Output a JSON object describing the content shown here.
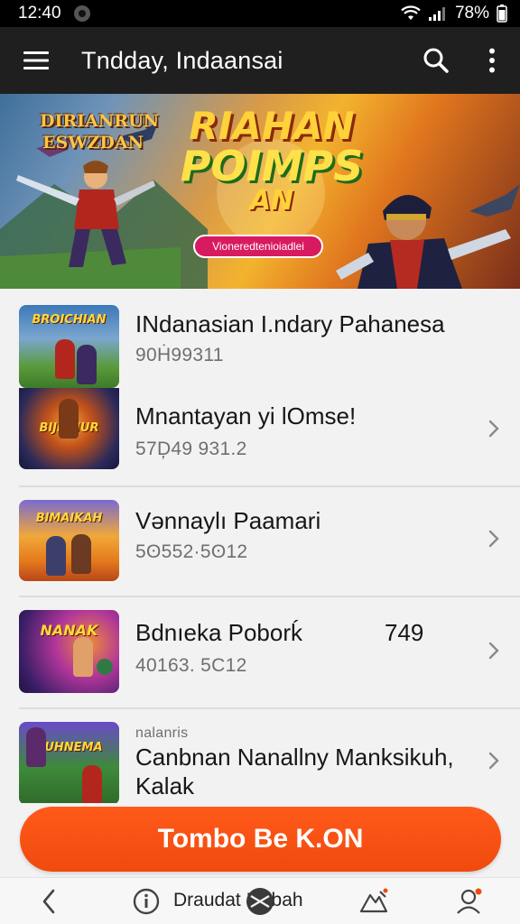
{
  "status_bar": {
    "time": "12:40",
    "battery": "78%"
  },
  "app_bar": {
    "title": "Tndday, Indaansai",
    "icons": [
      "menu-icon",
      "search-icon",
      "more-vert-icon"
    ]
  },
  "banner": {
    "logo_small_line1": "DIRIANRUN",
    "logo_small_line2": "ESWZDAN",
    "logo_big_line1": "RIAHAN",
    "logo_big_line2": "POIMPS",
    "logo_big_line3": "AN",
    "cta_label": "Vioneredtenioiadlei"
  },
  "list": {
    "items": [
      {
        "title": "INdanasian I.ndary Pahanesa",
        "subtitle": "90Ḣ99311",
        "thumb_label": "BROICHIAN",
        "has_chevron": false
      },
      {
        "title": "Mnantayan yi lOmse!",
        "subtitle": "57Ḑ49 931.2",
        "thumb_label": "BIJIAHUR",
        "has_chevron": true
      },
      {
        "title": "Vənnaylı Paamari",
        "subtitle": "5ʘ552·5ʘ12",
        "thumb_label": "BIMAIKAH",
        "has_chevron": true
      },
      {
        "title": "Bdnıeka Poborḱ",
        "badge": "749",
        "subtitle": "40163. 5C12",
        "thumb_label": "NANAK",
        "has_chevron": true
      },
      {
        "overline": "nalanris",
        "title": "Canbnan Nanallny Manksikuh,",
        "title_line2": "Kalak",
        "thumb_label": "BUHNEMA",
        "has_chevron": true
      }
    ]
  },
  "cta": {
    "label": "Tombo Be K.ON"
  },
  "bottom_nav": {
    "center_label": "Draudat Iatibah",
    "icons": [
      "back-icon",
      "info-icon",
      "cut-icon",
      "edit-icon",
      "profile-icon"
    ]
  },
  "colors": {
    "accent": "#f04a0e",
    "app_bar": "#1f1f1f",
    "banner_cta": "#d81b60"
  }
}
